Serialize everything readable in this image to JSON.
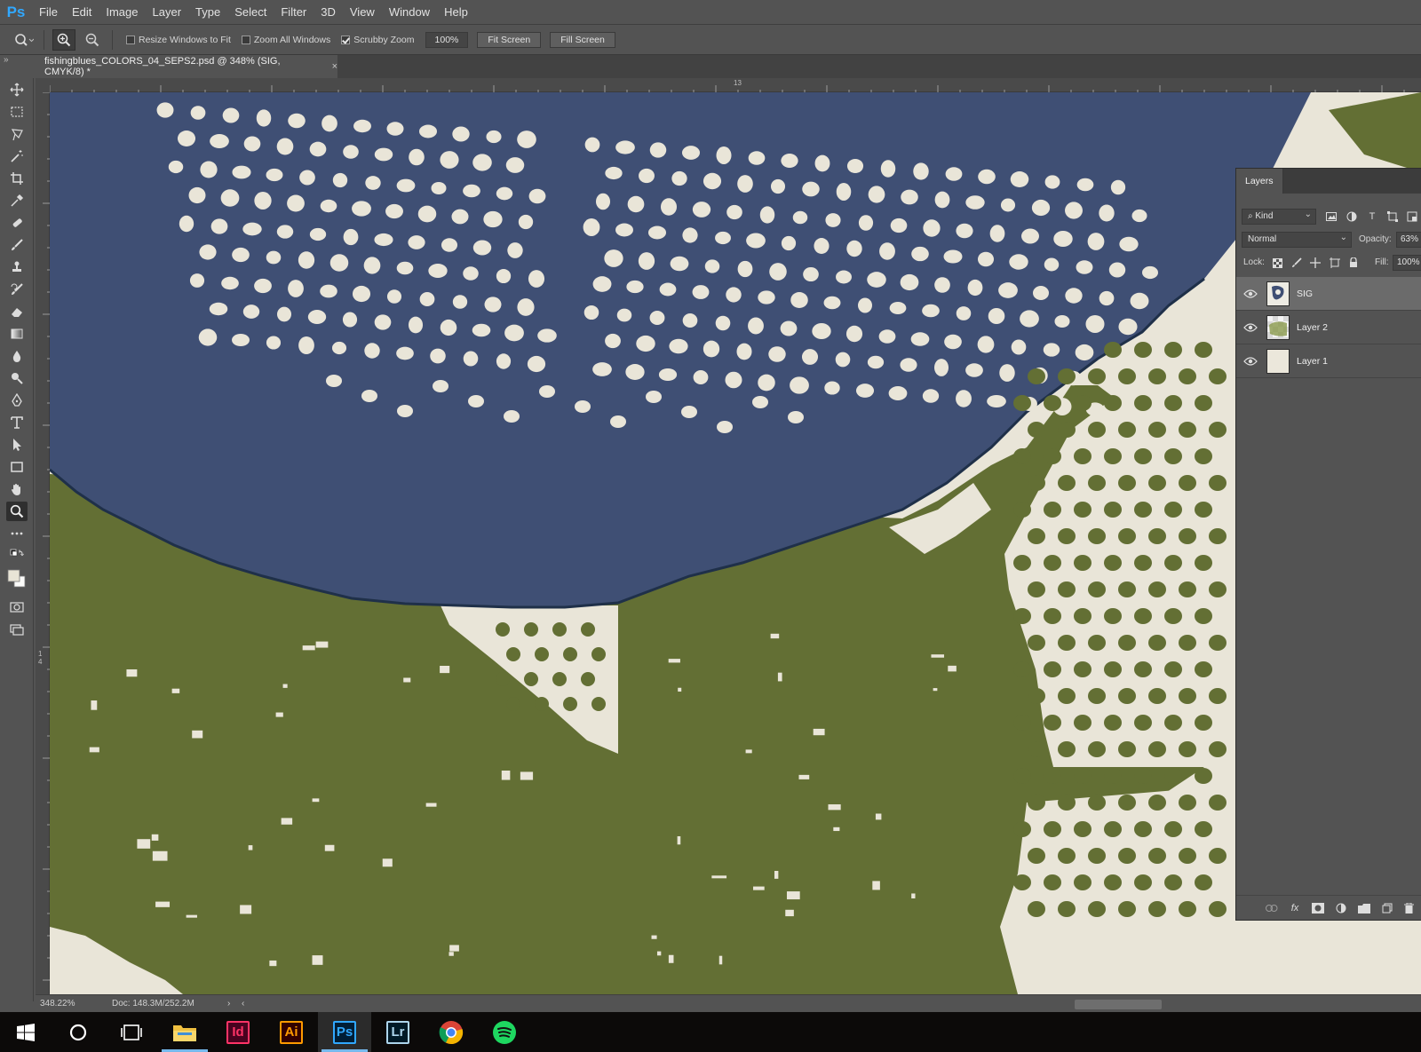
{
  "app": {
    "logo": "Ps"
  },
  "menu": [
    "File",
    "Edit",
    "Image",
    "Layer",
    "Type",
    "Select",
    "Filter",
    "3D",
    "View",
    "Window",
    "Help"
  ],
  "options": {
    "resize_windows": "Resize Windows to Fit",
    "zoom_all": "Zoom All Windows",
    "scrubby": "Scrubby Zoom",
    "zoom_value": "100%",
    "fit_screen": "Fit Screen",
    "fill_screen": "Fill Screen",
    "resize_checked": false,
    "zoom_all_checked": false,
    "scrubby_checked": true
  },
  "document": {
    "tab_title": "fishingblues_COLORS_04_SEPS2.psd @ 348% (SIG, CMYK/8) *",
    "close_glyph": "×"
  },
  "rulers": {
    "top_label": "13",
    "left_label": "1\n4"
  },
  "status": {
    "zoom": "348.22%",
    "doc": "Doc: 148.3M/252.2M",
    "arrow": "›",
    "scroll_left": "‹"
  },
  "layers_panel": {
    "tab": "Layers",
    "filter_kind": "Kind",
    "blend_mode": "Normal",
    "opacity_label": "Opacity:",
    "opacity_value": "63%",
    "lock_label": "Lock:",
    "fill_label": "Fill:",
    "fill_value": "100%",
    "layers": [
      {
        "name": "SIG",
        "selected": true
      },
      {
        "name": "Layer 2",
        "selected": false
      },
      {
        "name": "Layer 1",
        "selected": false
      }
    ],
    "footer_fx": "fx"
  },
  "taskbar": {
    "apps": [
      {
        "name": "start",
        "label": ""
      },
      {
        "name": "cortana",
        "label": ""
      },
      {
        "name": "task-view",
        "label": ""
      },
      {
        "name": "file-explorer",
        "label": ""
      },
      {
        "name": "indesign",
        "label": "Id",
        "color": "#ff3366"
      },
      {
        "name": "illustrator",
        "label": "Ai",
        "color": "#ff9a00"
      },
      {
        "name": "photoshop",
        "label": "Ps",
        "color": "#31a8ff"
      },
      {
        "name": "lightroom",
        "label": "Lr",
        "color": "#add5ec"
      },
      {
        "name": "chrome",
        "label": ""
      },
      {
        "name": "spotify",
        "label": ""
      }
    ]
  },
  "colors": {
    "navy": "#3f4f74",
    "olive": "#636f34",
    "cream": "#e9e5d8",
    "ui": "#535353"
  }
}
